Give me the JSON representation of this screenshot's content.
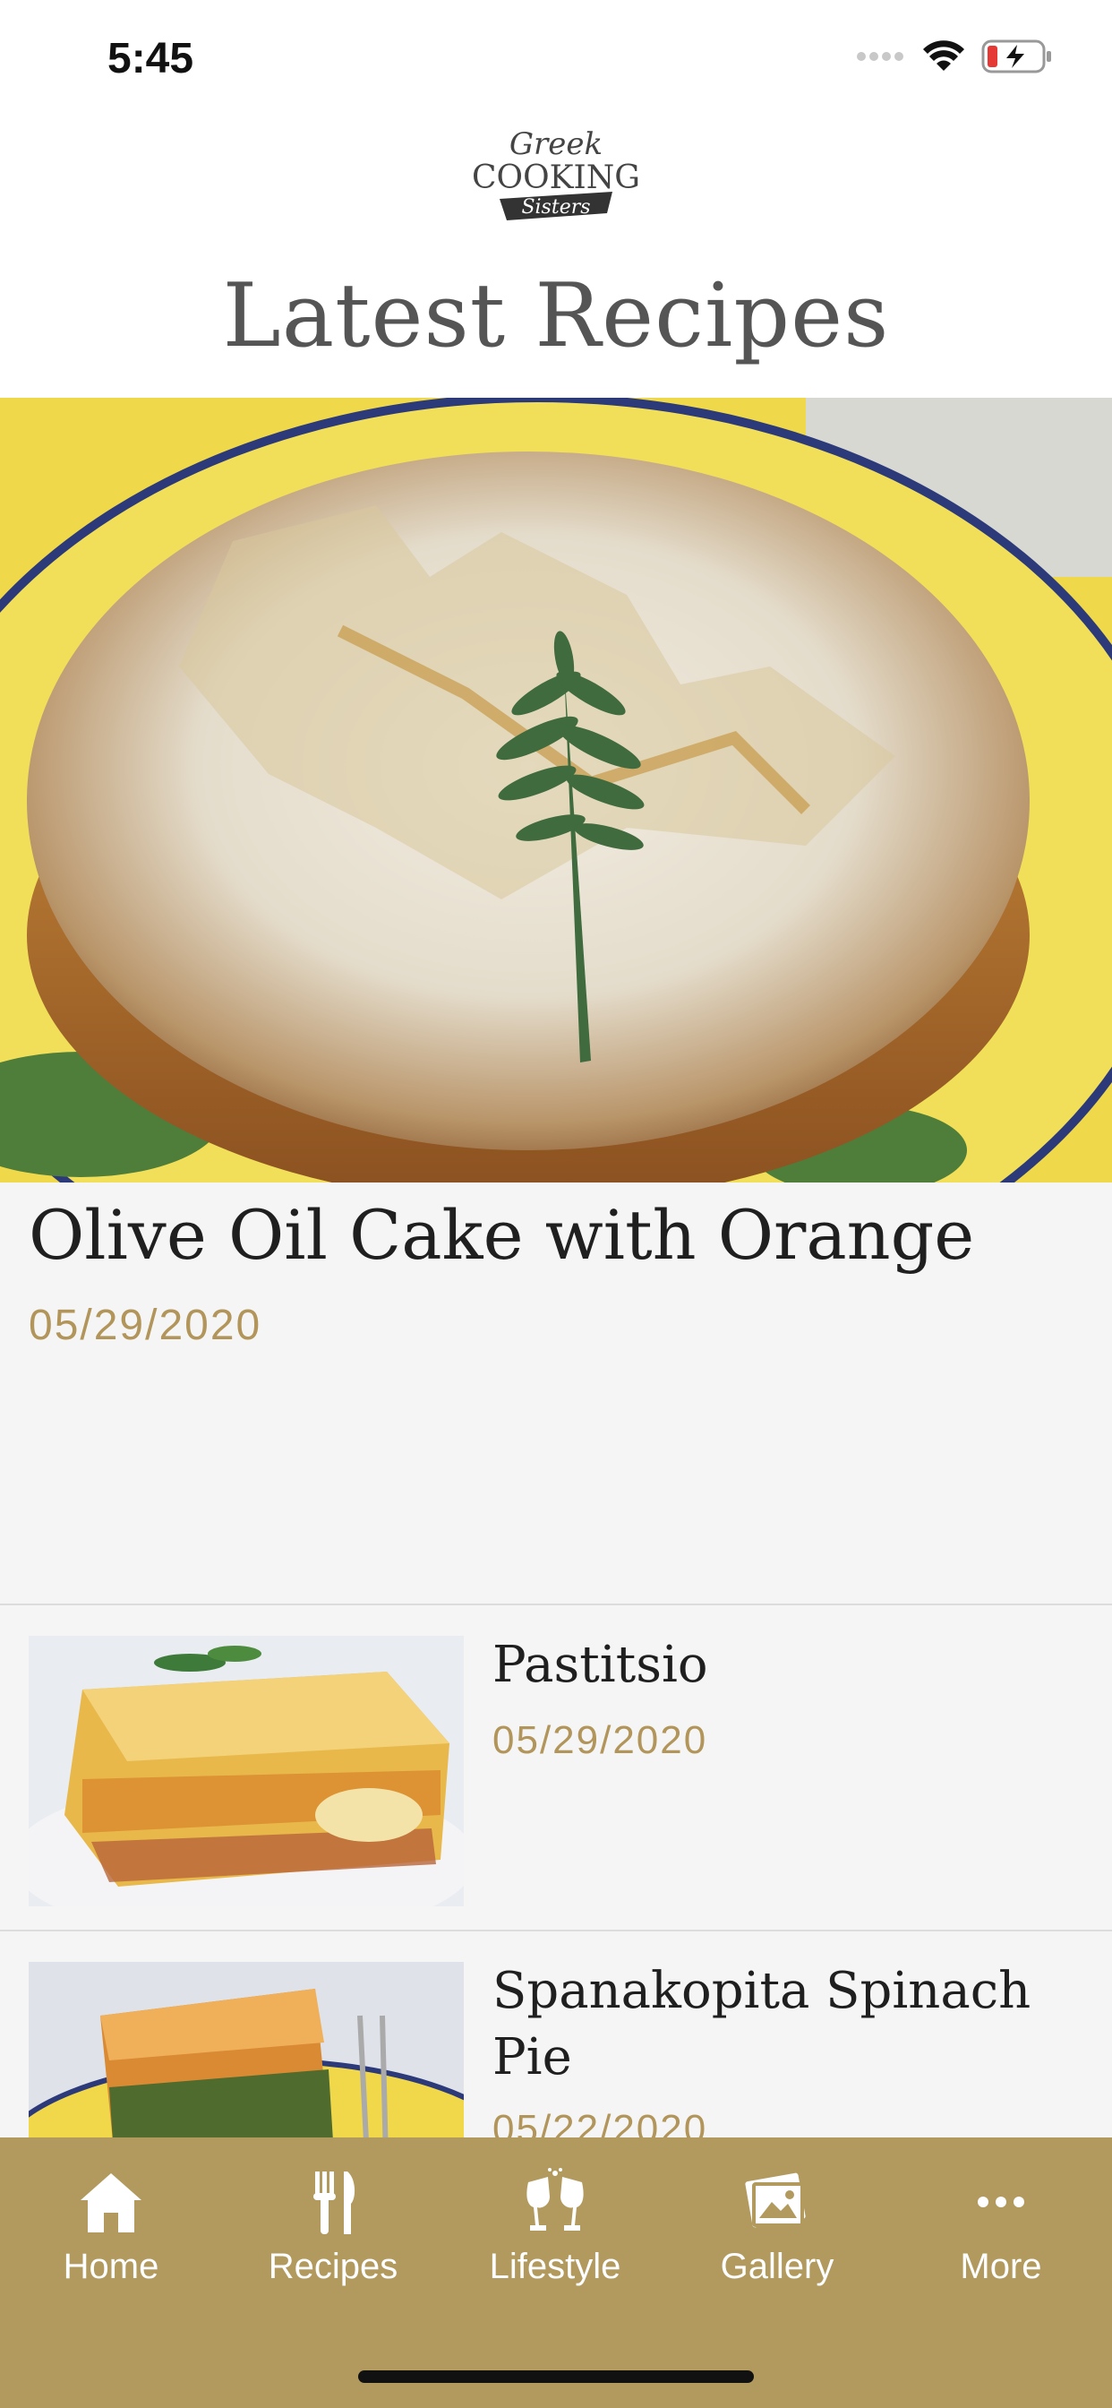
{
  "status": {
    "time": "5:45"
  },
  "brand": {
    "logo_line1": "Greek",
    "logo_line2": "COOKING",
    "logo_line3": "Sisters"
  },
  "page": {
    "title": "Latest Recipes"
  },
  "featured": {
    "title": "Olive Oil Cake with Orange",
    "date": "05/29/2020"
  },
  "recipes": [
    {
      "title": "Pastitsio",
      "date": "05/29/2020"
    },
    {
      "title": "Spanakopita Spinach Pie",
      "date": "05/22/2020"
    }
  ],
  "tabs": [
    {
      "label": "Home",
      "icon": "home-icon"
    },
    {
      "label": "Recipes",
      "icon": "fork-knife-icon"
    },
    {
      "label": "Lifestyle",
      "icon": "wine-glasses-icon"
    },
    {
      "label": "Gallery",
      "icon": "photo-icon"
    },
    {
      "label": "More",
      "icon": "more-dots-icon"
    }
  ],
  "colors": {
    "accent": "#b2955a",
    "tab_bar": "#b29a5e",
    "background": "#f5f5f5"
  }
}
